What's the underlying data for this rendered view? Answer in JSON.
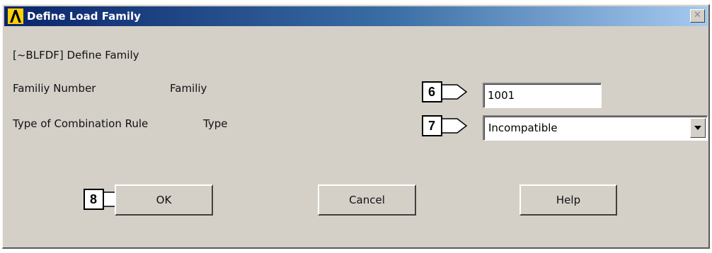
{
  "window": {
    "title": "Define Load Family",
    "close_glyph": "✕"
  },
  "command": {
    "label": "[~BLFDF] Define Family"
  },
  "family_number": {
    "label": "Familiy Number",
    "sublabel": "Familiy",
    "value": "1001"
  },
  "combination_rule": {
    "label": "Type of Combination Rule",
    "sublabel": "Type",
    "selected": "Incompatible"
  },
  "buttons": {
    "ok": "OK",
    "cancel": "Cancel",
    "help": "Help"
  },
  "callouts": {
    "six": "6",
    "seven": "7",
    "eight": "8"
  },
  "icons": {
    "app": "ansys-logo-icon",
    "close": "close-icon",
    "dropdown": "chevron-down-icon"
  },
  "colors": {
    "dialog_bg": "#d4d0c8",
    "titlebar_start": "#0a246a",
    "titlebar_end": "#a6caf0",
    "logo_yellow": "#ffd200"
  }
}
